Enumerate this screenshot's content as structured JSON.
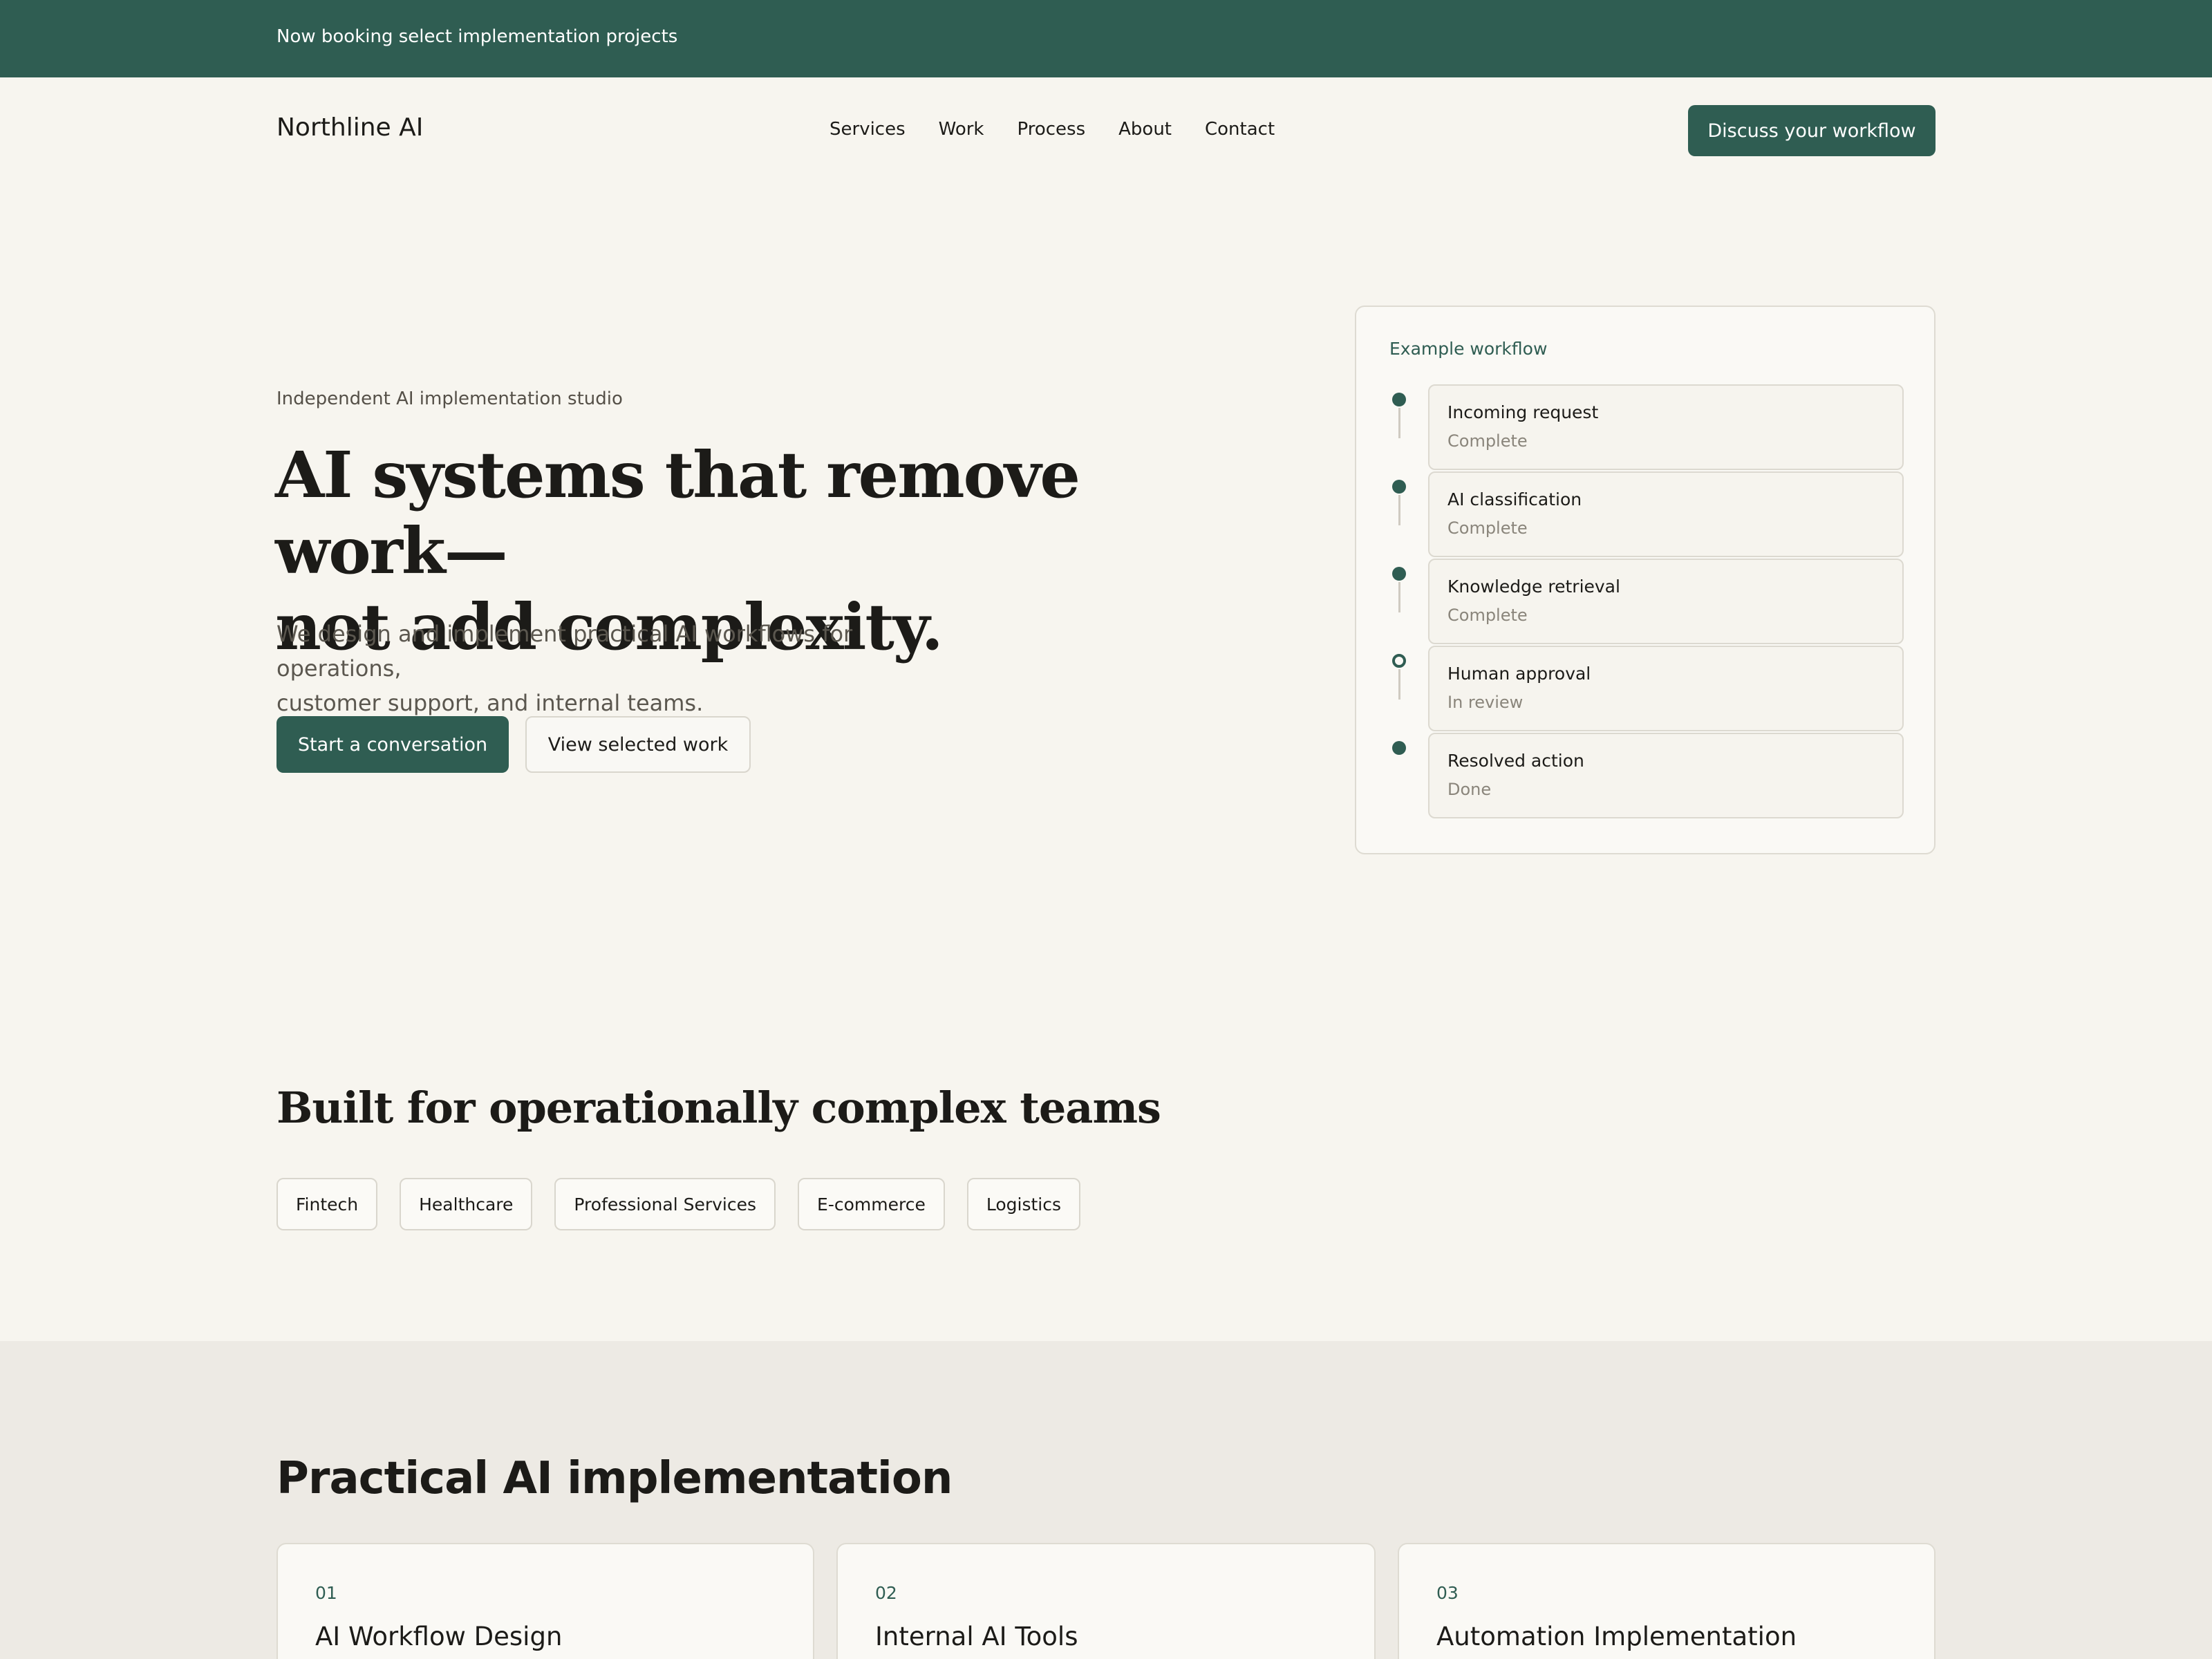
{
  "announcement": {
    "text": "Now booking select implementation projects"
  },
  "nav": {
    "brand": "Northline AI",
    "links": [
      "Services",
      "Work",
      "Process",
      "About",
      "Contact"
    ],
    "cta": "Discuss your workflow"
  },
  "hero": {
    "eyebrow": "Independent AI implementation studio",
    "title_line1": "AI systems that remove work—",
    "title_line2": "not add complexity.",
    "subtitle_line1": "We design and implement practical AI workflows for operations,",
    "subtitle_line2": "customer support, and internal teams.",
    "primary_cta": "Start a conversation",
    "secondary_cta": "View selected work"
  },
  "workflow": {
    "title": "Example workflow",
    "steps": [
      {
        "name": "Incoming request",
        "status": "Complete"
      },
      {
        "name": "AI classification",
        "status": "Complete"
      },
      {
        "name": "Knowledge retrieval",
        "status": "Complete"
      },
      {
        "name": "Human approval",
        "status": "In review"
      },
      {
        "name": "Resolved action",
        "status": "Done"
      }
    ]
  },
  "industries": {
    "title": "Built for operationally complex teams",
    "chips": [
      "Fintech",
      "Healthcare",
      "Professional Services",
      "E-commerce",
      "Logistics"
    ]
  },
  "services": {
    "title": "Practical AI implementation",
    "cards": [
      {
        "number": "01",
        "name": "AI Workflow Design"
      },
      {
        "number": "02",
        "name": "Internal AI Tools"
      },
      {
        "number": "03",
        "name": "Automation Implementation"
      }
    ]
  },
  "colors": {
    "accent": "#2f5d52",
    "background": "#f7f5ef",
    "band": "#edeae4"
  }
}
